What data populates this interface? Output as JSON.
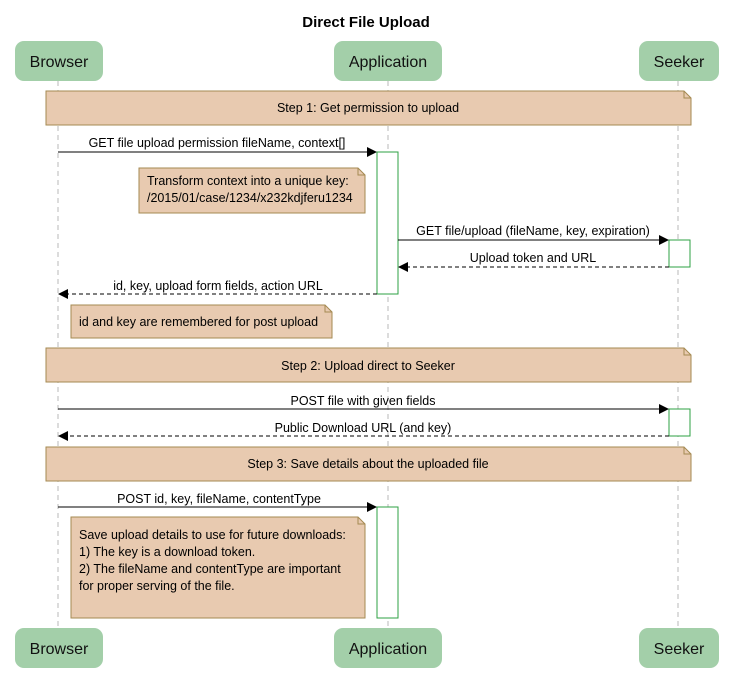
{
  "title": "Direct File Upload",
  "participants": [
    "Browser",
    "Application",
    "Seeker"
  ],
  "colors": {
    "participant": "#a3cfa9",
    "note": "#e8cab0",
    "note_border": "#a58a52",
    "activation": "#2ea043",
    "lifeline": "#b8b8b8"
  },
  "steps": [
    "Step 1: Get permission to upload",
    "Step 2: Upload direct to Seeker",
    "Step 3: Save details about the uploaded file"
  ],
  "messages": [
    "GET file upload permission fileName, context[]",
    "GET file/upload (fileName, key, expiration)",
    "Upload token and URL",
    "id, key, upload form fields, action URL",
    "POST file with given fields",
    "Public Download URL (and key)",
    "POST id, key, fileName, contentType"
  ],
  "notes": {
    "transform": [
      "Transform context into a unique key:",
      "/2015/01/case/1234/x232kdjferu1234"
    ],
    "remember": [
      "id and key are remembered for post upload"
    ],
    "save": [
      "Save upload details to use for future downloads:",
      "1) The key is a download token.",
      "2) The fileName and contentType are important",
      "for proper serving of the file."
    ]
  }
}
